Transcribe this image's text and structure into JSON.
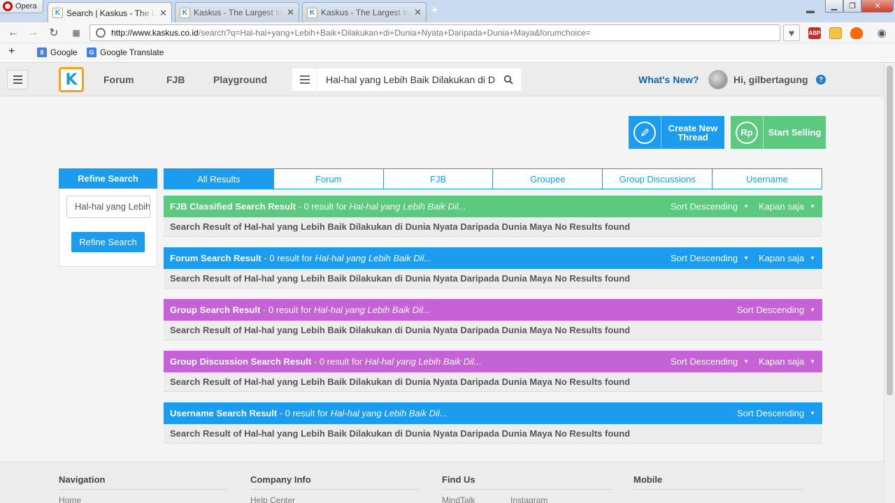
{
  "browser": {
    "menu_label": "Opera",
    "tabs": [
      {
        "title": "Search | Kaskus - The Largest Indonesian Community",
        "close": "✕"
      },
      {
        "title": "Kaskus - The Largest Indonesian Community",
        "close": "✕"
      },
      {
        "title": "Kaskus - The Largest Indonesian Community",
        "close": "✕"
      }
    ],
    "new_tab": "+",
    "url_domain": "http://www.kaskus.co.id",
    "url_rest": "/search?q=Hal-hal+yang+Lebih+Baik+Dilakukan+di+Dunia+Nyata+Daripada+Dunia+Maya&forumchoice=",
    "extensions": [
      "ABP",
      "",
      ""
    ],
    "bookmarks": [
      {
        "icon": "8",
        "label": "Google"
      },
      {
        "icon": "G",
        "label": "Google Translate"
      }
    ],
    "add_bookmark": "+"
  },
  "site": {
    "logo": "K",
    "nav": [
      "Forum",
      "FJB",
      "Playground"
    ],
    "search_value": "Hal-hal yang Lebih Baik Dilakukan di Dunia Nyata Daripada Dunia Maya",
    "whats_new": "What's New?",
    "greeting": "Hi, gilbertagung",
    "help": "?",
    "create_thread": {
      "line1": "Create New",
      "line2": "Thread"
    },
    "start_selling": {
      "label": "Start Selling",
      "icon_text": "Rp"
    },
    "colors": {
      "blue": "#1c9cef",
      "green": "#5bc97e",
      "purple": "#c563d6",
      "orange": "#f6a21d"
    }
  },
  "refine": {
    "title": "Refine Search",
    "input_value": "Hal-hal yang Lebih Baik Dilakukan di Dunia Nyata Daripada Dunia Maya",
    "button": "Refine Search"
  },
  "result_tabs": [
    "All Results",
    "Forum",
    "FJB",
    "Groupee",
    "Group Discussions",
    "Username"
  ],
  "sections": [
    {
      "title": "FJB Classified Search Result",
      "count": " - 0 result for ",
      "query": "Hal-hal yang Lebih Baik Dil...",
      "sort": "Sort Descending",
      "time": "Kapan saja",
      "body": "Search Result of Hal-hal yang Lebih Baik Dilakukan di Dunia Nyata Daripada Dunia Maya No Results found"
    },
    {
      "title": "Forum Search Result",
      "count": " - 0 result for ",
      "query": "Hal-hal yang Lebih Baik Dil...",
      "sort": "Sort Descending",
      "time": "Kapan saja",
      "body": "Search Result of Hal-hal yang Lebih Baik Dilakukan di Dunia Nyata Daripada Dunia Maya No Results found"
    },
    {
      "title": "Group Search Result",
      "count": " - 0 result for ",
      "query": "Hal-hal yang Lebih Baik Dil...",
      "sort": "Sort Descending",
      "body": "Search Result of Hal-hal yang Lebih Baik Dilakukan di Dunia Nyata Daripada Dunia Maya No Results found"
    },
    {
      "title": "Group Discussion Search Result",
      "count": " - 0 result for ",
      "query": "Hal-hal yang Lebih Baik Dil...",
      "sort": "Sort Descending",
      "time": "Kapan saja",
      "body": "Search Result of Hal-hal yang Lebih Baik Dilakukan di Dunia Nyata Daripada Dunia Maya No Results found"
    },
    {
      "title": "Username Search Result",
      "count": " - 0 result for ",
      "query": "Hal-hal yang Lebih Baik Dil...",
      "sort": "Sort Descending",
      "body": "Search Result of Hal-hal yang Lebih Baik Dilakukan di Dunia Nyata Daripada Dunia Maya No Results found"
    }
  ],
  "footer": {
    "columns": [
      "Navigation",
      "Company Info",
      "Find Us",
      "Mobile"
    ],
    "links": [
      "Home",
      "Help Center",
      "MindTalk",
      "Instagram"
    ]
  }
}
